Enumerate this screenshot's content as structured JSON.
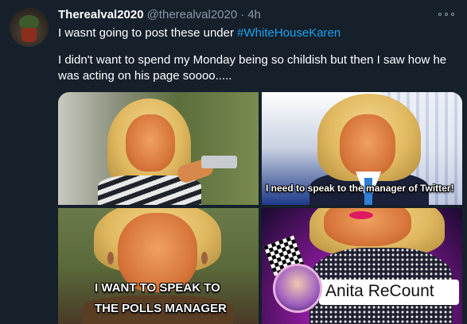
{
  "tweet": {
    "author_name": "Therealval2020",
    "handle": "@therealval2020",
    "separator": "·",
    "time": "4h",
    "line1_before": "I wasnt going to post these under ",
    "hashtag": "#WhiteHouseKaren",
    "line2": "I didn't want to spend my Monday being so childish but then I saw how he was acting on his page soooo....."
  },
  "media": {
    "captions": {
      "tile2": "I need to speak to the manager of Twitter!",
      "tile3_line1": "I WANT TO SPEAK TO",
      "tile3_line2": "THE POLLS MANAGER",
      "tile4": "Anita ReCount"
    }
  },
  "colors": {
    "background": "#15202b",
    "text": "#ffffff",
    "secondary": "#8899a6",
    "link": "#1da1f2"
  },
  "icons": {
    "more": "more-icon"
  }
}
